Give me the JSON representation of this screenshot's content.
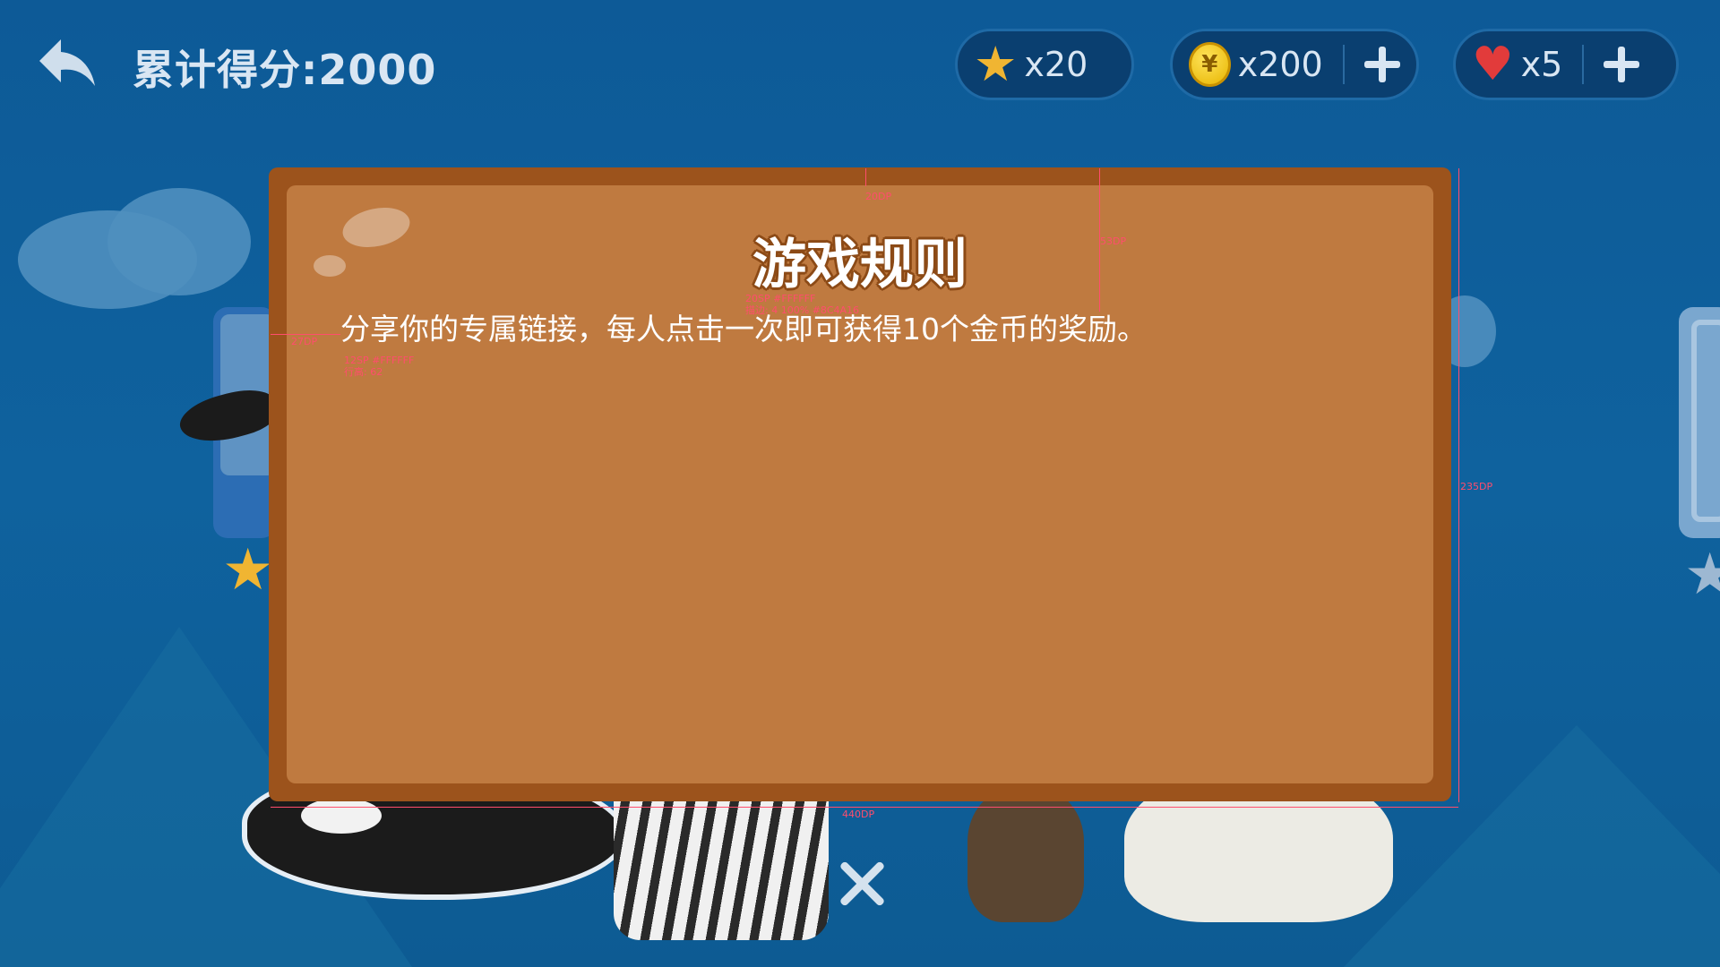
{
  "header": {
    "score_label": "累计得分:2000",
    "stars": "x20",
    "coins": "x200",
    "lives": "x5",
    "coin_symbol": "¥"
  },
  "modal": {
    "title": "游戏规则",
    "body": "分享你的专属链接，每人点击一次即可获得10个金币的奖励。"
  },
  "annotations": {
    "top_margin": "20DP",
    "title_height": "53DP",
    "title_spec_1": "20SP #FFFFFF",
    "title_spec_2": "描边: 4 100% #8C4A16",
    "left_margin": "27DP",
    "body_spec_1": "12SP #FFFFFF",
    "body_spec_2": "行高: 62",
    "modal_height": "235DP",
    "modal_width": "440DP"
  },
  "colors": {
    "modal_border": "#9c531c",
    "modal_fill": "#bf7a40",
    "title_stroke": "#8C4A16",
    "background": "#0f629e"
  },
  "icons": {
    "back": "back-arrow-icon",
    "star": "star-icon",
    "coin": "coin-icon",
    "heart": "heart-icon",
    "plus": "plus-icon",
    "close": "close-icon"
  }
}
